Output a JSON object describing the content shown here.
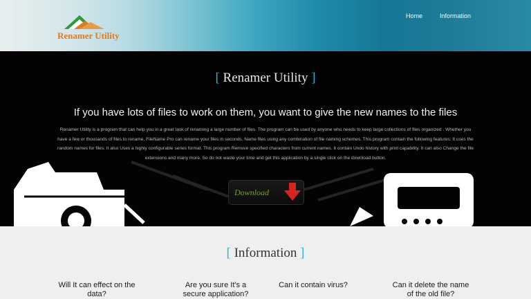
{
  "header": {
    "logo_text": "Renamer Utility",
    "nav": [
      "Home",
      "Information"
    ]
  },
  "hero": {
    "title": "Renamer Utility",
    "headline": "If you have lots of files to work on them, you want to give the new names to the files",
    "description": "Renamer Utility is a program that can help you in a great task of renaming a large number of files. The program can be used by anyone who needs to keep large collections of files organized . Whether you have a few or thousands of files to rename, FileName Pro can rename your files in seconds. Name files using any combination of file naming schemes. This program contain the following features: It uses the random names for files. It also Uses a highly configurable series format. This program Remove specified characters from current names. It contain Undo history with print capability. It can also Change the file extensions and many more. So do not waste your time and get this application by a single click on the download button.",
    "download_label": "Download"
  },
  "info": {
    "title": "Information",
    "questions": [
      "Will It can effect on the data?",
      "Are you sure It's a secure application?",
      "Can it contain virus?",
      "Can it delete the name of the old file?"
    ]
  },
  "colors": {
    "bracket_accent": "#2fb0d6",
    "logo_orange": "#e07a1c",
    "logo_green": "#2e9a3c",
    "download_green": "#78a326",
    "download_arrow_red": "#d8231e"
  }
}
